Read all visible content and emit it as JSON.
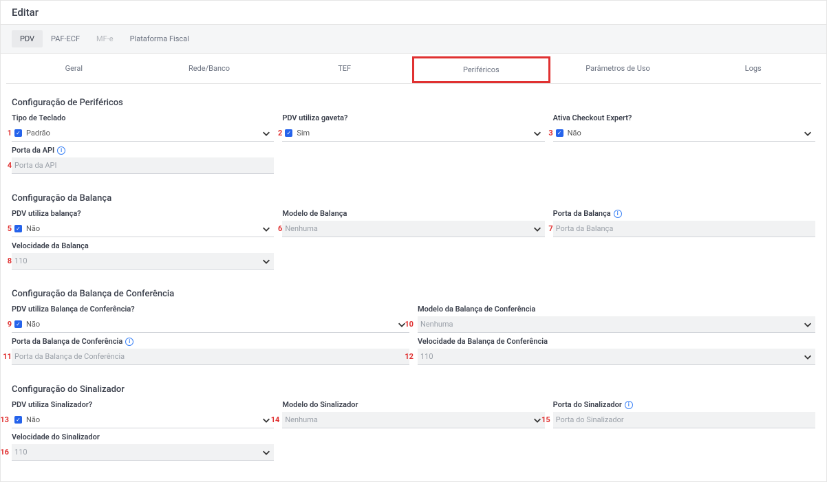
{
  "page_title": "Editar",
  "top_tabs": {
    "pdv": "PDV",
    "paf_ecf": "PAF-ECF",
    "mfe": "MF-e",
    "plataforma": "Plataforma Fiscal"
  },
  "sub_tabs": {
    "geral": "Geral",
    "rede_banco": "Rede/Banco",
    "tef": "TEF",
    "perifericos": "Periféricos",
    "parametros": "Parâmetros de Uso",
    "logs": "Logs"
  },
  "sections": {
    "perif": {
      "title": "Configuração de Periféricos",
      "tipo_teclado_label": "Tipo de Teclado",
      "tipo_teclado_value": "Padrão",
      "pdv_gaveta_label": "PDV utiliza gaveta?",
      "pdv_gaveta_value": "Sim",
      "ativa_checkout_label": "Ativa Checkout Expert?",
      "ativa_checkout_value": "Não",
      "porta_api_label": "Porta da API",
      "porta_api_placeholder": "Porta da API"
    },
    "balanca": {
      "title": "Configuração da Balança",
      "pdv_balanca_label": "PDV utiliza balança?",
      "pdv_balanca_value": "Não",
      "modelo_label": "Modelo de Balança",
      "modelo_value": "Nenhuma",
      "porta_label": "Porta da Balança",
      "porta_placeholder": "Porta da Balança",
      "velocidade_label": "Velocidade da Balança",
      "velocidade_value": "110"
    },
    "conf": {
      "title": "Configuração da Balança de Conferência",
      "pdv_label": "PDV utiliza Balança de Conferência?",
      "pdv_value": "Não",
      "modelo_label": "Modelo da Balança de Conferência",
      "modelo_value": "Nenhuma",
      "porta_label": "Porta da Balança de Conferência",
      "porta_placeholder": "Porta da Balança de Conferência",
      "velocidade_label": "Velocidade da Balança de Conferência",
      "velocidade_value": "110"
    },
    "sinal": {
      "title": "Configuração do Sinalizador",
      "pdv_label": "PDV utiliza Sinalizador?",
      "pdv_value": "Não",
      "modelo_label": "Modelo do Sinalizador",
      "modelo_value": "Nenhuma",
      "porta_label": "Porta do Sinalizador",
      "porta_placeholder": "Porta do Sinalizador",
      "velocidade_label": "Velocidade do Sinalizador",
      "velocidade_value": "110"
    }
  },
  "badges": {
    "b1": "1",
    "b2": "2",
    "b3": "3",
    "b4": "4",
    "b5": "5",
    "b6": "6",
    "b7": "7",
    "b8": "8",
    "b9": "9",
    "b10": "10",
    "b11": "11",
    "b12": "12",
    "b13": "13",
    "b14": "14",
    "b15": "15",
    "b16": "16"
  }
}
